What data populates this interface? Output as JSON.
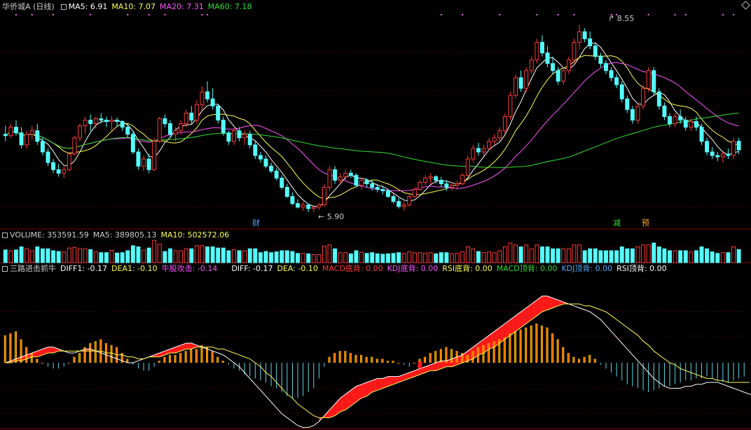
{
  "colors": {
    "up": "#ff3b3b",
    "down": "#54ffff",
    "ma5": "#ffffff",
    "ma10": "#ffff55",
    "ma20": "#ff55ff",
    "ma60": "#33dd33",
    "text": "#cccccc",
    "marker": "#ff66ff"
  },
  "price_header": {
    "title": "华侨城A (日线)",
    "ma5": "MA5: 6.91",
    "ma10": "MA10: 7.07",
    "ma20": "MA20: 7.31",
    "ma60": "MA60: 7.18"
  },
  "volume_header": {
    "vol": "VOLUME: 353591.59",
    "ma5": "MA5: 389805.13",
    "ma10": "MA10: 502572.06"
  },
  "macd_header": {
    "name": "三路进击抓牛",
    "diff1": "DIFF1: -0.17",
    "dea1": "DEA1: -0.10",
    "attack": "牛股攻击: -0.14",
    "diff": "DIFF: -0.17",
    "dea": "DEA: -0.10",
    "macd_bottom": "MACD底背: 0.00",
    "kdj_bottom": "KDJ底背: 0.00",
    "rsi_bottom": "RSI底背: 0.00",
    "macd_top": "MACD顶背: 0.00",
    "kdj_top": "KDJ顶背: 0.00",
    "rsi_top": "RSI顶背: 0.00"
  },
  "annotations": {
    "high": "8.55",
    "low": "5.90",
    "cai": "财",
    "jian": "减",
    "yu": "预"
  },
  "chart_data": {
    "type": "candlestick",
    "x_count": 140,
    "ylim": [
      5.75,
      8.7
    ],
    "ohlc": [
      [
        7.0,
        7.12,
        6.9,
        6.98
      ],
      [
        6.98,
        7.15,
        6.95,
        7.1
      ],
      [
        7.1,
        7.2,
        6.98,
        7.02
      ],
      [
        7.02,
        7.1,
        6.8,
        6.85
      ],
      [
        6.85,
        7.05,
        6.8,
        7.0
      ],
      [
        7.0,
        7.12,
        6.92,
        7.05
      ],
      [
        7.05,
        7.15,
        6.85,
        6.9
      ],
      [
        6.9,
        6.95,
        6.7,
        6.75
      ],
      [
        6.75,
        6.8,
        6.55,
        6.6
      ],
      [
        6.6,
        6.65,
        6.45,
        6.5
      ],
      [
        6.5,
        6.58,
        6.4,
        6.45
      ],
      [
        6.45,
        6.55,
        6.38,
        6.5
      ],
      [
        6.5,
        6.75,
        6.48,
        6.72
      ],
      [
        6.72,
        6.98,
        6.7,
        6.95
      ],
      [
        6.95,
        7.15,
        6.9,
        7.12
      ],
      [
        7.12,
        7.25,
        7.0,
        7.2
      ],
      [
        7.2,
        7.28,
        7.05,
        7.15
      ],
      [
        7.15,
        7.25,
        7.08,
        7.22
      ],
      [
        7.22,
        7.3,
        7.15,
        7.2
      ],
      [
        7.2,
        7.25,
        7.1,
        7.18
      ],
      [
        7.18,
        7.26,
        7.05,
        7.2
      ],
      [
        7.2,
        7.24,
        7.1,
        7.18
      ],
      [
        7.18,
        7.2,
        7.05,
        7.1
      ],
      [
        7.1,
        7.15,
        6.95,
        7.0
      ],
      [
        7.0,
        7.05,
        6.72,
        6.75
      ],
      [
        6.75,
        6.8,
        6.5,
        6.55
      ],
      [
        6.55,
        6.7,
        6.48,
        6.65
      ],
      [
        6.65,
        6.72,
        6.45,
        6.5
      ],
      [
        6.5,
        6.95,
        6.48,
        6.9
      ],
      [
        6.9,
        7.25,
        6.88,
        7.22
      ],
      [
        7.22,
        7.28,
        7.1,
        7.15
      ],
      [
        7.15,
        7.2,
        6.95,
        7.0
      ],
      [
        7.0,
        7.1,
        6.9,
        7.05
      ],
      [
        7.05,
        7.2,
        7.0,
        7.15
      ],
      [
        7.15,
        7.35,
        7.1,
        7.3
      ],
      [
        7.3,
        7.4,
        7.15,
        7.2
      ],
      [
        7.2,
        7.48,
        7.15,
        7.42
      ],
      [
        7.42,
        7.68,
        7.35,
        7.6
      ],
      [
        7.6,
        7.75,
        7.45,
        7.5
      ],
      [
        7.5,
        7.65,
        7.35,
        7.4
      ],
      [
        7.4,
        7.42,
        7.15,
        7.2
      ],
      [
        7.2,
        7.25,
        6.98,
        7.02
      ],
      [
        7.02,
        7.05,
        6.85,
        6.9
      ],
      [
        6.9,
        7.08,
        6.85,
        7.05
      ],
      [
        7.05,
        7.1,
        6.9,
        6.95
      ],
      [
        6.95,
        7.05,
        6.85,
        7.0
      ],
      [
        7.0,
        7.05,
        6.8,
        6.85
      ],
      [
        6.85,
        6.9,
        6.65,
        6.7
      ],
      [
        6.7,
        6.75,
        6.6,
        6.65
      ],
      [
        6.65,
        6.7,
        6.52,
        6.55
      ],
      [
        6.55,
        6.6,
        6.45,
        6.48
      ],
      [
        6.48,
        6.52,
        6.35,
        6.38
      ],
      [
        6.38,
        6.42,
        6.22,
        6.25
      ],
      [
        6.25,
        6.3,
        6.1,
        6.12
      ],
      [
        6.12,
        6.18,
        6.0,
        6.02
      ],
      [
        6.02,
        6.08,
        5.95,
        5.97
      ],
      [
        5.97,
        6.05,
        5.92,
        6.0
      ],
      [
        6.0,
        6.02,
        5.9,
        5.95
      ],
      [
        5.95,
        6.0,
        5.9,
        5.97
      ],
      [
        5.97,
        6.03,
        5.93,
        6.0
      ],
      [
        6.0,
        6.3,
        5.98,
        6.25
      ],
      [
        6.25,
        6.55,
        6.2,
        6.5
      ],
      [
        6.5,
        6.55,
        6.3,
        6.35
      ],
      [
        6.35,
        6.45,
        6.3,
        6.4
      ],
      [
        6.4,
        6.5,
        6.35,
        6.45
      ],
      [
        6.45,
        6.5,
        6.38,
        6.42
      ],
      [
        6.42,
        6.45,
        6.25,
        6.28
      ],
      [
        6.28,
        6.38,
        6.22,
        6.35
      ],
      [
        6.35,
        6.38,
        6.25,
        6.3
      ],
      [
        6.3,
        6.35,
        6.2,
        6.25
      ],
      [
        6.25,
        6.3,
        6.18,
        6.22
      ],
      [
        6.22,
        6.26,
        6.15,
        6.2
      ],
      [
        6.2,
        6.22,
        6.1,
        6.12
      ],
      [
        6.12,
        6.15,
        6.02,
        6.05
      ],
      [
        6.05,
        6.1,
        5.95,
        5.98
      ],
      [
        5.98,
        6.05,
        5.92,
        6.0
      ],
      [
        6.0,
        6.15,
        5.98,
        6.12
      ],
      [
        6.12,
        6.25,
        6.1,
        6.22
      ],
      [
        6.22,
        6.35,
        6.2,
        6.32
      ],
      [
        6.32,
        6.42,
        6.28,
        6.38
      ],
      [
        6.38,
        6.45,
        6.3,
        6.4
      ],
      [
        6.4,
        6.42,
        6.3,
        6.35
      ],
      [
        6.35,
        6.4,
        6.25,
        6.3
      ],
      [
        6.3,
        6.35,
        6.2,
        6.25
      ],
      [
        6.25,
        6.32,
        6.2,
        6.28
      ],
      [
        6.28,
        6.35,
        6.22,
        6.3
      ],
      [
        6.3,
        6.45,
        6.28,
        6.42
      ],
      [
        6.42,
        6.7,
        6.4,
        6.65
      ],
      [
        6.65,
        6.85,
        6.6,
        6.8
      ],
      [
        6.8,
        6.88,
        6.7,
        6.75
      ],
      [
        6.75,
        6.85,
        6.7,
        6.8
      ],
      [
        6.8,
        6.95,
        6.78,
        6.9
      ],
      [
        6.9,
        7.0,
        6.85,
        6.95
      ],
      [
        6.95,
        7.1,
        6.9,
        7.05
      ],
      [
        7.05,
        7.3,
        7.0,
        7.25
      ],
      [
        7.25,
        7.6,
        7.2,
        7.55
      ],
      [
        7.55,
        7.85,
        7.5,
        7.8
      ],
      [
        7.8,
        7.9,
        7.6,
        7.65
      ],
      [
        7.65,
        7.95,
        7.6,
        7.9
      ],
      [
        7.9,
        8.1,
        7.85,
        8.05
      ],
      [
        8.05,
        8.35,
        8.0,
        8.3
      ],
      [
        8.3,
        8.4,
        8.1,
        8.15
      ],
      [
        8.15,
        8.25,
        7.95,
        8.0
      ],
      [
        8.0,
        8.1,
        7.85,
        7.9
      ],
      [
        7.9,
        7.95,
        7.7,
        7.75
      ],
      [
        7.75,
        7.95,
        7.7,
        7.9
      ],
      [
        7.9,
        8.1,
        7.85,
        8.05
      ],
      [
        8.05,
        8.35,
        8.0,
        8.3
      ],
      [
        8.3,
        8.55,
        8.2,
        8.45
      ],
      [
        8.45,
        8.5,
        8.3,
        8.35
      ],
      [
        8.35,
        8.45,
        8.2,
        8.25
      ],
      [
        8.25,
        8.3,
        8.05,
        8.1
      ],
      [
        8.1,
        8.15,
        7.95,
        8.0
      ],
      [
        8.0,
        8.05,
        7.85,
        7.9
      ],
      [
        7.9,
        7.95,
        7.75,
        7.8
      ],
      [
        7.8,
        7.85,
        7.65,
        7.7
      ],
      [
        7.7,
        7.75,
        7.45,
        7.5
      ],
      [
        7.5,
        7.55,
        7.3,
        7.35
      ],
      [
        7.35,
        7.4,
        7.15,
        7.2
      ],
      [
        7.2,
        7.45,
        7.15,
        7.4
      ],
      [
        7.4,
        7.7,
        7.35,
        7.65
      ],
      [
        7.65,
        7.95,
        7.6,
        7.9
      ],
      [
        7.9,
        7.95,
        7.55,
        7.6
      ],
      [
        7.6,
        7.65,
        7.35,
        7.4
      ],
      [
        7.4,
        7.45,
        7.2,
        7.25
      ],
      [
        7.25,
        7.3,
        7.1,
        7.15
      ],
      [
        7.15,
        7.3,
        7.1,
        7.25
      ],
      [
        7.25,
        7.35,
        7.15,
        7.2
      ],
      [
        7.2,
        7.25,
        7.05,
        7.1
      ],
      [
        7.1,
        7.22,
        7.05,
        7.18
      ],
      [
        7.18,
        7.25,
        7.05,
        7.1
      ],
      [
        7.1,
        7.15,
        6.85,
        6.9
      ],
      [
        6.9,
        6.95,
        6.7,
        6.75
      ],
      [
        6.75,
        6.82,
        6.65,
        6.7
      ],
      [
        6.7,
        6.75,
        6.62,
        6.68
      ],
      [
        6.68,
        6.75,
        6.6,
        6.72
      ],
      [
        6.72,
        6.8,
        6.65,
        6.7
      ],
      [
        6.7,
        6.95,
        6.65,
        6.9
      ],
      [
        6.9,
        6.95,
        6.72,
        6.78
      ]
    ],
    "macd_hist": [
      0.14,
      0.15,
      0.16,
      0.12,
      0.08,
      0.05,
      0.02,
      0.0,
      -0.02,
      -0.03,
      -0.03,
      -0.02,
      0.0,
      0.03,
      0.05,
      0.08,
      0.1,
      0.11,
      0.12,
      0.1,
      0.09,
      0.08,
      0.05,
      0.02,
      -0.01,
      -0.03,
      -0.04,
      -0.04,
      -0.02,
      0.01,
      0.03,
      0.04,
      0.04,
      0.05,
      0.06,
      0.07,
      0.07,
      0.09,
      0.08,
      0.06,
      0.03,
      0.01,
      -0.01,
      -0.03,
      -0.04,
      -0.06,
      -0.07,
      -0.08,
      -0.09,
      -0.1,
      -0.12,
      -0.13,
      -0.15,
      -0.17,
      -0.18,
      -0.18,
      -0.17,
      -0.15,
      -0.13,
      -0.08,
      -0.02,
      0.03,
      0.05,
      0.06,
      0.06,
      0.05,
      0.04,
      0.04,
      0.03,
      0.03,
      0.02,
      0.02,
      0.01,
      0.01,
      0.0,
      -0.01,
      -0.02,
      0.0,
      0.02,
      0.03,
      0.05,
      0.06,
      0.07,
      0.08,
      0.07,
      0.06,
      0.05,
      0.04,
      0.06,
      0.08,
      0.09,
      0.1,
      0.11,
      0.12,
      0.13,
      0.15,
      0.16,
      0.17,
      0.18,
      0.19,
      0.2,
      0.19,
      0.18,
      0.15,
      0.12,
      0.08,
      0.05,
      0.03,
      0.02,
      0.03,
      0.04,
      0.02,
      -0.01,
      -0.03,
      -0.05,
      -0.07,
      -0.09,
      -0.11,
      -0.12,
      -0.13,
      -0.14,
      -0.15,
      -0.14,
      -0.13,
      -0.12,
      -0.12,
      -0.11,
      -0.1,
      -0.09,
      -0.09,
      -0.08,
      -0.08,
      -0.07,
      -0.08,
      -0.09,
      -0.1,
      -0.1,
      -0.09,
      -0.08,
      -0.07
    ],
    "diff": [
      0.0,
      0.01,
      0.02,
      0.03,
      0.04,
      0.05,
      0.06,
      0.07,
      0.08,
      0.08,
      0.07,
      0.06,
      0.05,
      0.05,
      0.06,
      0.07,
      0.07,
      0.06,
      0.05,
      0.04,
      0.03,
      0.02,
      0.01,
      0.0,
      0.0,
      0.01,
      0.02,
      0.03,
      0.04,
      0.05,
      0.06,
      0.07,
      0.08,
      0.09,
      0.1,
      0.1,
      0.09,
      0.08,
      0.07,
      0.06,
      0.05,
      0.04,
      0.02,
      0.0,
      -0.02,
      -0.05,
      -0.08,
      -0.11,
      -0.14,
      -0.17,
      -0.2,
      -0.23,
      -0.26,
      -0.28,
      -0.3,
      -0.32,
      -0.33,
      -0.33,
      -0.32,
      -0.3,
      -0.27,
      -0.24,
      -0.21,
      -0.18,
      -0.16,
      -0.14,
      -0.12,
      -0.11,
      -0.1,
      -0.09,
      -0.08,
      -0.08,
      -0.07,
      -0.07,
      -0.07,
      -0.06,
      -0.05,
      -0.04,
      -0.03,
      -0.02,
      -0.01,
      0.0,
      0.01,
      0.01,
      0.02,
      0.03,
      0.04,
      0.06,
      0.08,
      0.1,
      0.12,
      0.14,
      0.16,
      0.18,
      0.2,
      0.22,
      0.24,
      0.26,
      0.28,
      0.3,
      0.32,
      0.34,
      0.34,
      0.33,
      0.32,
      0.31,
      0.3,
      0.29,
      0.28,
      0.27,
      0.26,
      0.24,
      0.22,
      0.19,
      0.16,
      0.13,
      0.1,
      0.07,
      0.04,
      0.01,
      -0.02,
      -0.05,
      -0.08,
      -0.1,
      -0.12,
      -0.13,
      -0.13,
      -0.13,
      -0.12,
      -0.12,
      -0.11,
      -0.11,
      -0.1,
      -0.1,
      -0.1,
      -0.11,
      -0.12,
      -0.13,
      -0.14,
      -0.15,
      -0.16,
      -0.17
    ],
    "dea": [
      0.0,
      0.0,
      0.01,
      0.01,
      0.02,
      0.03,
      0.03,
      0.04,
      0.05,
      0.05,
      0.06,
      0.06,
      0.06,
      0.06,
      0.06,
      0.06,
      0.06,
      0.06,
      0.06,
      0.05,
      0.05,
      0.04,
      0.04,
      0.03,
      0.03,
      0.02,
      0.02,
      0.03,
      0.03,
      0.03,
      0.04,
      0.05,
      0.05,
      0.06,
      0.07,
      0.07,
      0.08,
      0.08,
      0.08,
      0.08,
      0.07,
      0.07,
      0.06,
      0.05,
      0.04,
      0.03,
      0.02,
      0.0,
      -0.02,
      -0.05,
      -0.07,
      -0.1,
      -0.13,
      -0.16,
      -0.18,
      -0.21,
      -0.23,
      -0.25,
      -0.27,
      -0.28,
      -0.28,
      -0.28,
      -0.27,
      -0.25,
      -0.24,
      -0.22,
      -0.2,
      -0.18,
      -0.17,
      -0.15,
      -0.14,
      -0.13,
      -0.12,
      -0.11,
      -0.1,
      -0.09,
      -0.08,
      -0.07,
      -0.06,
      -0.05,
      -0.04,
      -0.04,
      -0.03,
      -0.02,
      -0.02,
      -0.01,
      0.0,
      0.01,
      0.02,
      0.04,
      0.05,
      0.07,
      0.08,
      0.1,
      0.12,
      0.14,
      0.16,
      0.18,
      0.2,
      0.22,
      0.24,
      0.26,
      0.27,
      0.28,
      0.29,
      0.3,
      0.3,
      0.3,
      0.3,
      0.29,
      0.29,
      0.28,
      0.27,
      0.26,
      0.24,
      0.22,
      0.2,
      0.18,
      0.16,
      0.14,
      0.11,
      0.09,
      0.06,
      0.04,
      0.02,
      0.0,
      -0.01,
      -0.03,
      -0.04,
      -0.05,
      -0.06,
      -0.07,
      -0.08,
      -0.08,
      -0.09,
      -0.09,
      -0.1,
      -0.1,
      -0.1,
      -0.1,
      -0.1
    ]
  }
}
